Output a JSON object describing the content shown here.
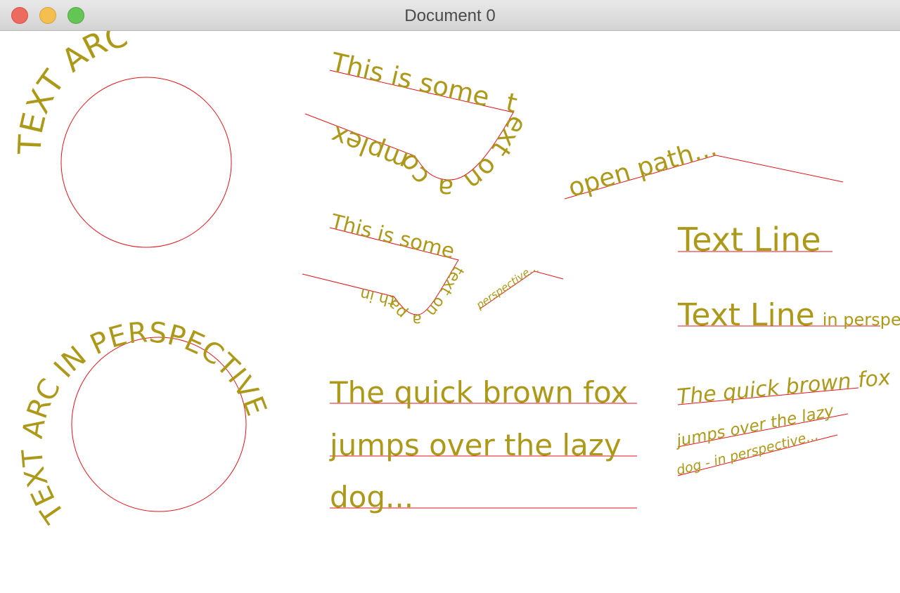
{
  "window": {
    "title": "Document 0",
    "buttons": {
      "close": "close",
      "minimize": "minimize",
      "zoom": "zoom"
    }
  },
  "colors": {
    "text": "#ad9919",
    "guide": "#e0131b",
    "titlebar": "#dcdcdc"
  },
  "canvas": {
    "text_arc": "TEXT ARC",
    "text_arc_perspective": "TEXT ARC IN PERSPECTIVE",
    "complex_path_top": "This is some",
    "complex_path_bottom": "text on a complex",
    "open_path": "open path...",
    "perspective_path_top": "This is some",
    "perspective_path_bottom": "text on a path in",
    "perspective_small": "perspective...",
    "text_line": "Text Line",
    "text_line_persp_big": "Text Line",
    "text_line_persp_small": "in perspective",
    "paragraph": [
      "The quick brown fox",
      "jumps over the lazy",
      "dog..."
    ],
    "paragraph_perspective": [
      "The quick brown fox",
      "jumps over the lazy",
      "dog - in perspective..."
    ]
  }
}
